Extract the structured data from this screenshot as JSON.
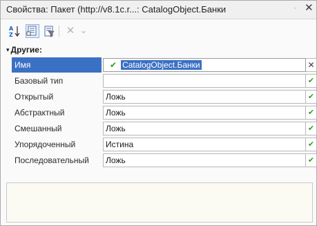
{
  "window": {
    "title": "Свойства: Пакет (http://v8.1c.r...: CatalogObject.Банки",
    "pin_glyph": "◦",
    "close_glyph": "✕"
  },
  "toolbar": {
    "sort_icon": "sort-az-icon",
    "categories_icon": "categories-icon",
    "filter_icon": "filter-icon",
    "delete_glyph": "✕",
    "dropdown_glyph": "⌄"
  },
  "group": {
    "arrow": "▾",
    "title": "Другие:"
  },
  "properties": [
    {
      "label": "Имя",
      "value": "CatalogObject.Банки",
      "selected": true,
      "button": "✕"
    },
    {
      "label": "Базовый тип",
      "value": "",
      "selected": false,
      "button": "✔"
    },
    {
      "label": "Открытый",
      "value": "Ложь",
      "selected": false,
      "button": "✔"
    },
    {
      "label": "Абстрактный",
      "value": "Ложь",
      "selected": false,
      "button": "✔"
    },
    {
      "label": "Смешанный",
      "value": "Ложь",
      "selected": false,
      "button": "✔"
    },
    {
      "label": "Упорядоченный",
      "value": "Истина",
      "selected": false,
      "button": "✔"
    },
    {
      "label": "Последовательный",
      "value": "Ложь",
      "selected": false,
      "button": "✔"
    }
  ],
  "name_check_glyph": "✔",
  "colors": {
    "selection": "#3b71c5",
    "check_green": "#2e9e2e",
    "description_bg": "#fbfaf3"
  }
}
